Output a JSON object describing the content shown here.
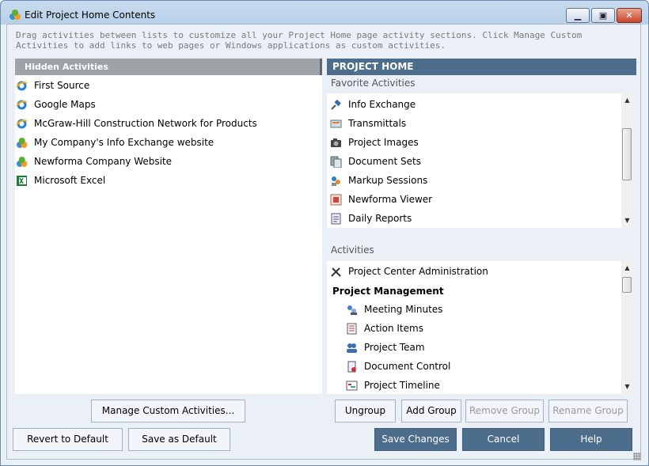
{
  "window": {
    "title": "Edit Project Home Contents"
  },
  "description": "Drag activities between lists to customize all your Project Home page activity sections.  Click Manage Custom Activities to add links to web pages or Windows applications as custom activities.",
  "hidden": {
    "header": "Hidden Activities",
    "items": [
      {
        "label": "First Source",
        "icon": "ie-icon"
      },
      {
        "label": "Google Maps",
        "icon": "ie-icon"
      },
      {
        "label": "McGraw-Hill Construction Network for Products",
        "icon": "ie-icon"
      },
      {
        "label": "My Company's Info Exchange website",
        "icon": "newforma-icon"
      },
      {
        "label": "Newforma Company Website",
        "icon": "newforma-icon"
      },
      {
        "label": "Microsoft Excel",
        "icon": "excel-icon"
      }
    ]
  },
  "project_home": {
    "header": "PROJECT HOME",
    "favorites_label": "Favorite Activities",
    "favorites": [
      {
        "label": "Info Exchange",
        "icon": "satellite-icon"
      },
      {
        "label": "Transmittals",
        "icon": "transmittal-icon"
      },
      {
        "label": "Project Images",
        "icon": "camera-icon"
      },
      {
        "label": "Document Sets",
        "icon": "document-sets-icon"
      },
      {
        "label": "Markup Sessions",
        "icon": "markup-icon"
      },
      {
        "label": "Newforma Viewer",
        "icon": "viewer-icon"
      },
      {
        "label": "Daily Reports",
        "icon": "report-icon"
      }
    ],
    "activities_label": "Activities",
    "activities_top": [
      {
        "label": "Project Center Administration",
        "icon": "tools-icon"
      }
    ],
    "group_label": "Project Management",
    "group_items": [
      {
        "label": "Meeting Minutes",
        "icon": "meeting-icon"
      },
      {
        "label": "Action Items",
        "icon": "action-items-icon"
      },
      {
        "label": "Project Team",
        "icon": "team-icon"
      },
      {
        "label": "Document Control",
        "icon": "document-control-icon"
      },
      {
        "label": "Project Timeline",
        "icon": "timeline-icon"
      }
    ]
  },
  "buttons": {
    "manage": "Manage Custom Activities...",
    "ungroup": "Ungroup",
    "add_group": "Add Group",
    "remove_group": "Remove Group",
    "rename_group": "Rename Group",
    "revert": "Revert to Default",
    "save_default": "Save as Default",
    "save_changes": "Save Changes",
    "cancel": "Cancel",
    "help": "Help"
  }
}
